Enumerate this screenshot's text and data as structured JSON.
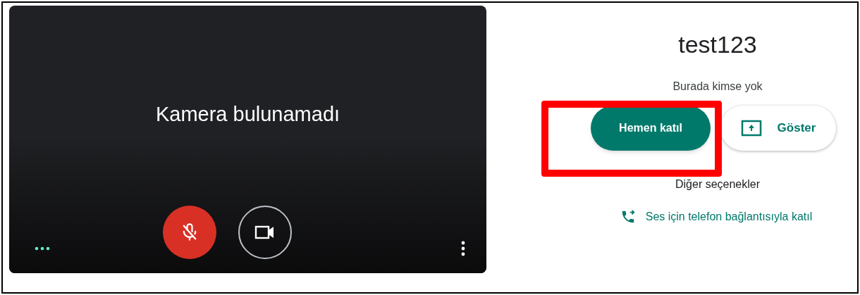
{
  "preview": {
    "message": "Kamera bulunamadı",
    "mic": {
      "muted": true
    }
  },
  "meeting": {
    "title": "test123",
    "status": "Burada kimse yok",
    "buttons": [
      {
        "kind": "primary",
        "label": "Hemen katıl"
      },
      {
        "kind": "present",
        "label": "Göster"
      }
    ],
    "other_options": {
      "title": "Diğer seçenekler",
      "link": "Ses için telefon bağlantısıyla katıl"
    }
  }
}
